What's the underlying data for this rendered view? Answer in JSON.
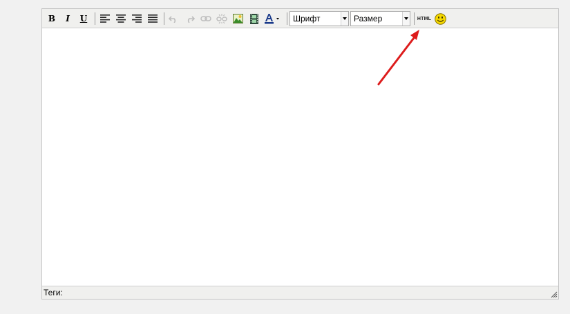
{
  "toolbar": {
    "bold_label": "B",
    "italic_label": "I",
    "underline_label": "U",
    "font_select": {
      "value": "Шрифт"
    },
    "size_select": {
      "value": "Размер"
    },
    "html_label": "HTML"
  },
  "statusbar": {
    "tags_label": "Теги:"
  },
  "colors": {
    "arrow": "#dd1c1c",
    "image_icon": "#3a8c2a",
    "smiley": "#f5d800"
  }
}
